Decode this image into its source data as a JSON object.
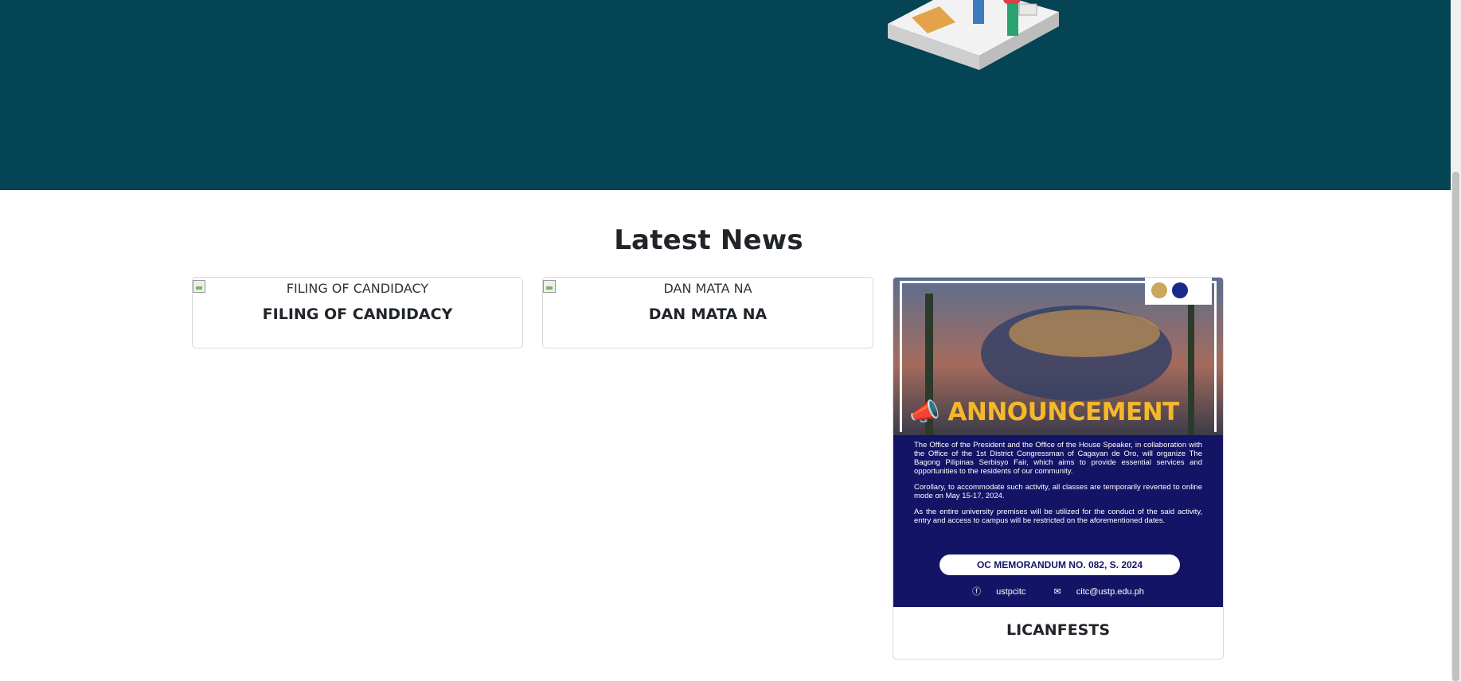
{
  "section": {
    "title": "Latest News"
  },
  "news": [
    {
      "image_alt": "FILING OF CANDIDACY",
      "title": "FILING OF CANDIDACY"
    },
    {
      "image_alt": "DAN MATA NA",
      "title": "DAN MATA NA"
    },
    {
      "title": "LICANFESTS",
      "poster": {
        "headline": "ANNOUNCEMENT",
        "para1": "The Office of the President and the Office of the House Speaker, in collaboration with the Office of the 1st District Congressman of Cagayan de Oro, will organize The Bagong Pilipinas Serbisyo Fair, which aims to provide essential services and opportunities to the residents of our community.",
        "para2": "Corollary, to accommodate such activity, all classes are temporarily reverted to online mode on May 15-17, 2024.",
        "para3": "As the entire university premises will be utilized for the conduct of the said activity, entry and access to campus will be restricted on the aforementioned dates.",
        "memo": "OC MEMORANDUM NO. 082, S. 2024",
        "facebook": "ustpcitc",
        "email": "citc@ustp.edu.ph"
      }
    }
  ],
  "colors": {
    "hero_bg": "#044454",
    "poster_bg": "#141467",
    "accent": "#f6b82b"
  }
}
